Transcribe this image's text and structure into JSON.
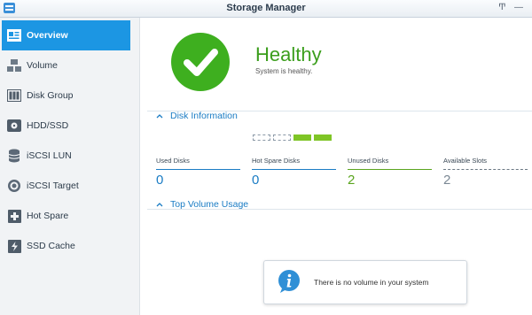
{
  "window": {
    "title": "Storage Manager"
  },
  "titlebar_controls": {
    "pin_glyph": "Ͳ",
    "minimize_glyph": "—"
  },
  "sidebar": {
    "items": [
      {
        "label": "Overview",
        "icon": "overview-icon",
        "active": true
      },
      {
        "label": "Volume",
        "icon": "volume-icon",
        "active": false
      },
      {
        "label": "Disk Group",
        "icon": "disk-group-icon",
        "active": false
      },
      {
        "label": "HDD/SSD",
        "icon": "hdd-icon",
        "active": false
      },
      {
        "label": "iSCSI LUN",
        "icon": "iscsi-lun-icon",
        "active": false
      },
      {
        "label": "iSCSI Target",
        "icon": "iscsi-target-icon",
        "active": false
      },
      {
        "label": "Hot Spare",
        "icon": "hot-spare-icon",
        "active": false
      },
      {
        "label": "SSD Cache",
        "icon": "ssd-cache-icon",
        "active": false
      }
    ]
  },
  "status": {
    "title": "Healthy",
    "subtitle": "System is healthy.",
    "color": "#3eaf1f",
    "icon": "check-icon"
  },
  "disk_info": {
    "heading": "Disk Information",
    "slots": [
      "empty",
      "empty",
      "unused",
      "unused"
    ],
    "stats": [
      {
        "label": "Used Disks",
        "value": "0",
        "color": "#1a7cc4"
      },
      {
        "label": "Hot Spare Disks",
        "value": "0",
        "color": "#1a7cc4"
      },
      {
        "label": "Unused Disks",
        "value": "2",
        "color": "#5aa51e"
      },
      {
        "label": "Available Slots",
        "value": "2",
        "color": "#7b8894"
      }
    ]
  },
  "top_volume": {
    "heading": "Top Volume Usage",
    "empty_message": "There is no volume in your system",
    "info_icon": "info-icon"
  }
}
